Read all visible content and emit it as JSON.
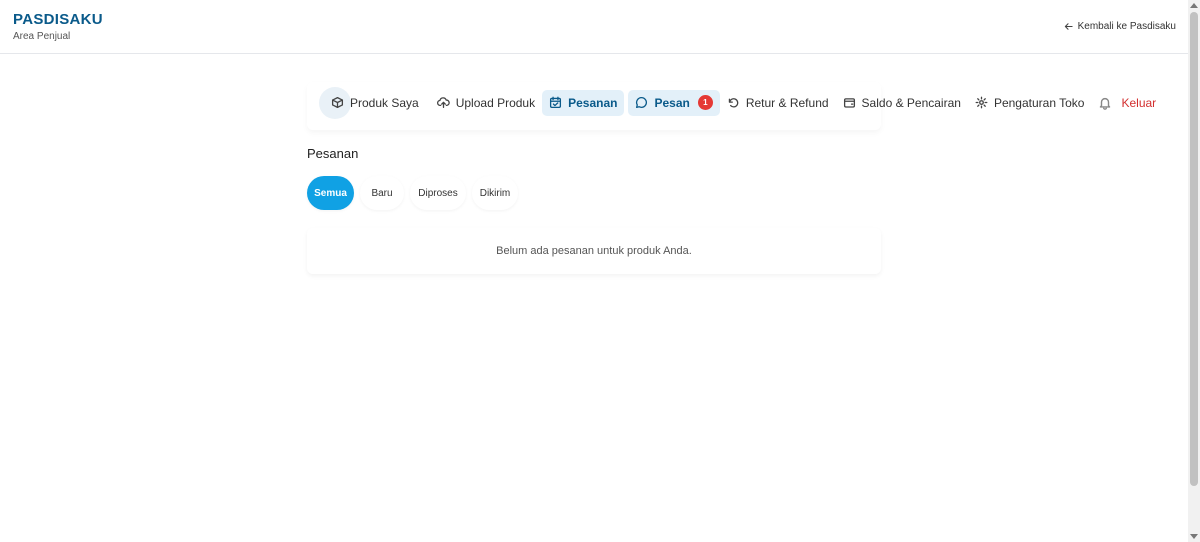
{
  "header": {
    "brand": "PASDISAKU",
    "subtitle": "Area Penjual",
    "back_link": "Kembali ke Pasdisaku"
  },
  "nav": {
    "items": [
      {
        "label": "Produk Saya",
        "icon": "box-icon"
      },
      {
        "label": "Upload Produk",
        "icon": "cloud-upload-icon"
      },
      {
        "label": "Pesanan",
        "icon": "calendar-check-icon"
      },
      {
        "label": "Pesan",
        "icon": "chat-bubble-icon",
        "badge": "1"
      },
      {
        "label": "Retur & Refund",
        "icon": "undo-icon"
      },
      {
        "label": "Saldo & Pencairan",
        "icon": "wallet-icon"
      },
      {
        "label": "Pengaturan Toko",
        "icon": "gear-icon"
      }
    ],
    "logout": "Keluar"
  },
  "page": {
    "title": "Pesanan",
    "tabs": [
      "Semua",
      "Baru",
      "Diproses",
      "Dikirim"
    ],
    "empty_message": "Belum ada pesanan untuk produk Anda."
  },
  "colors": {
    "brand": "#0a5a8a",
    "active_tab": "#10a1e4",
    "badge": "#e53935",
    "logout": "#d32f2f"
  }
}
